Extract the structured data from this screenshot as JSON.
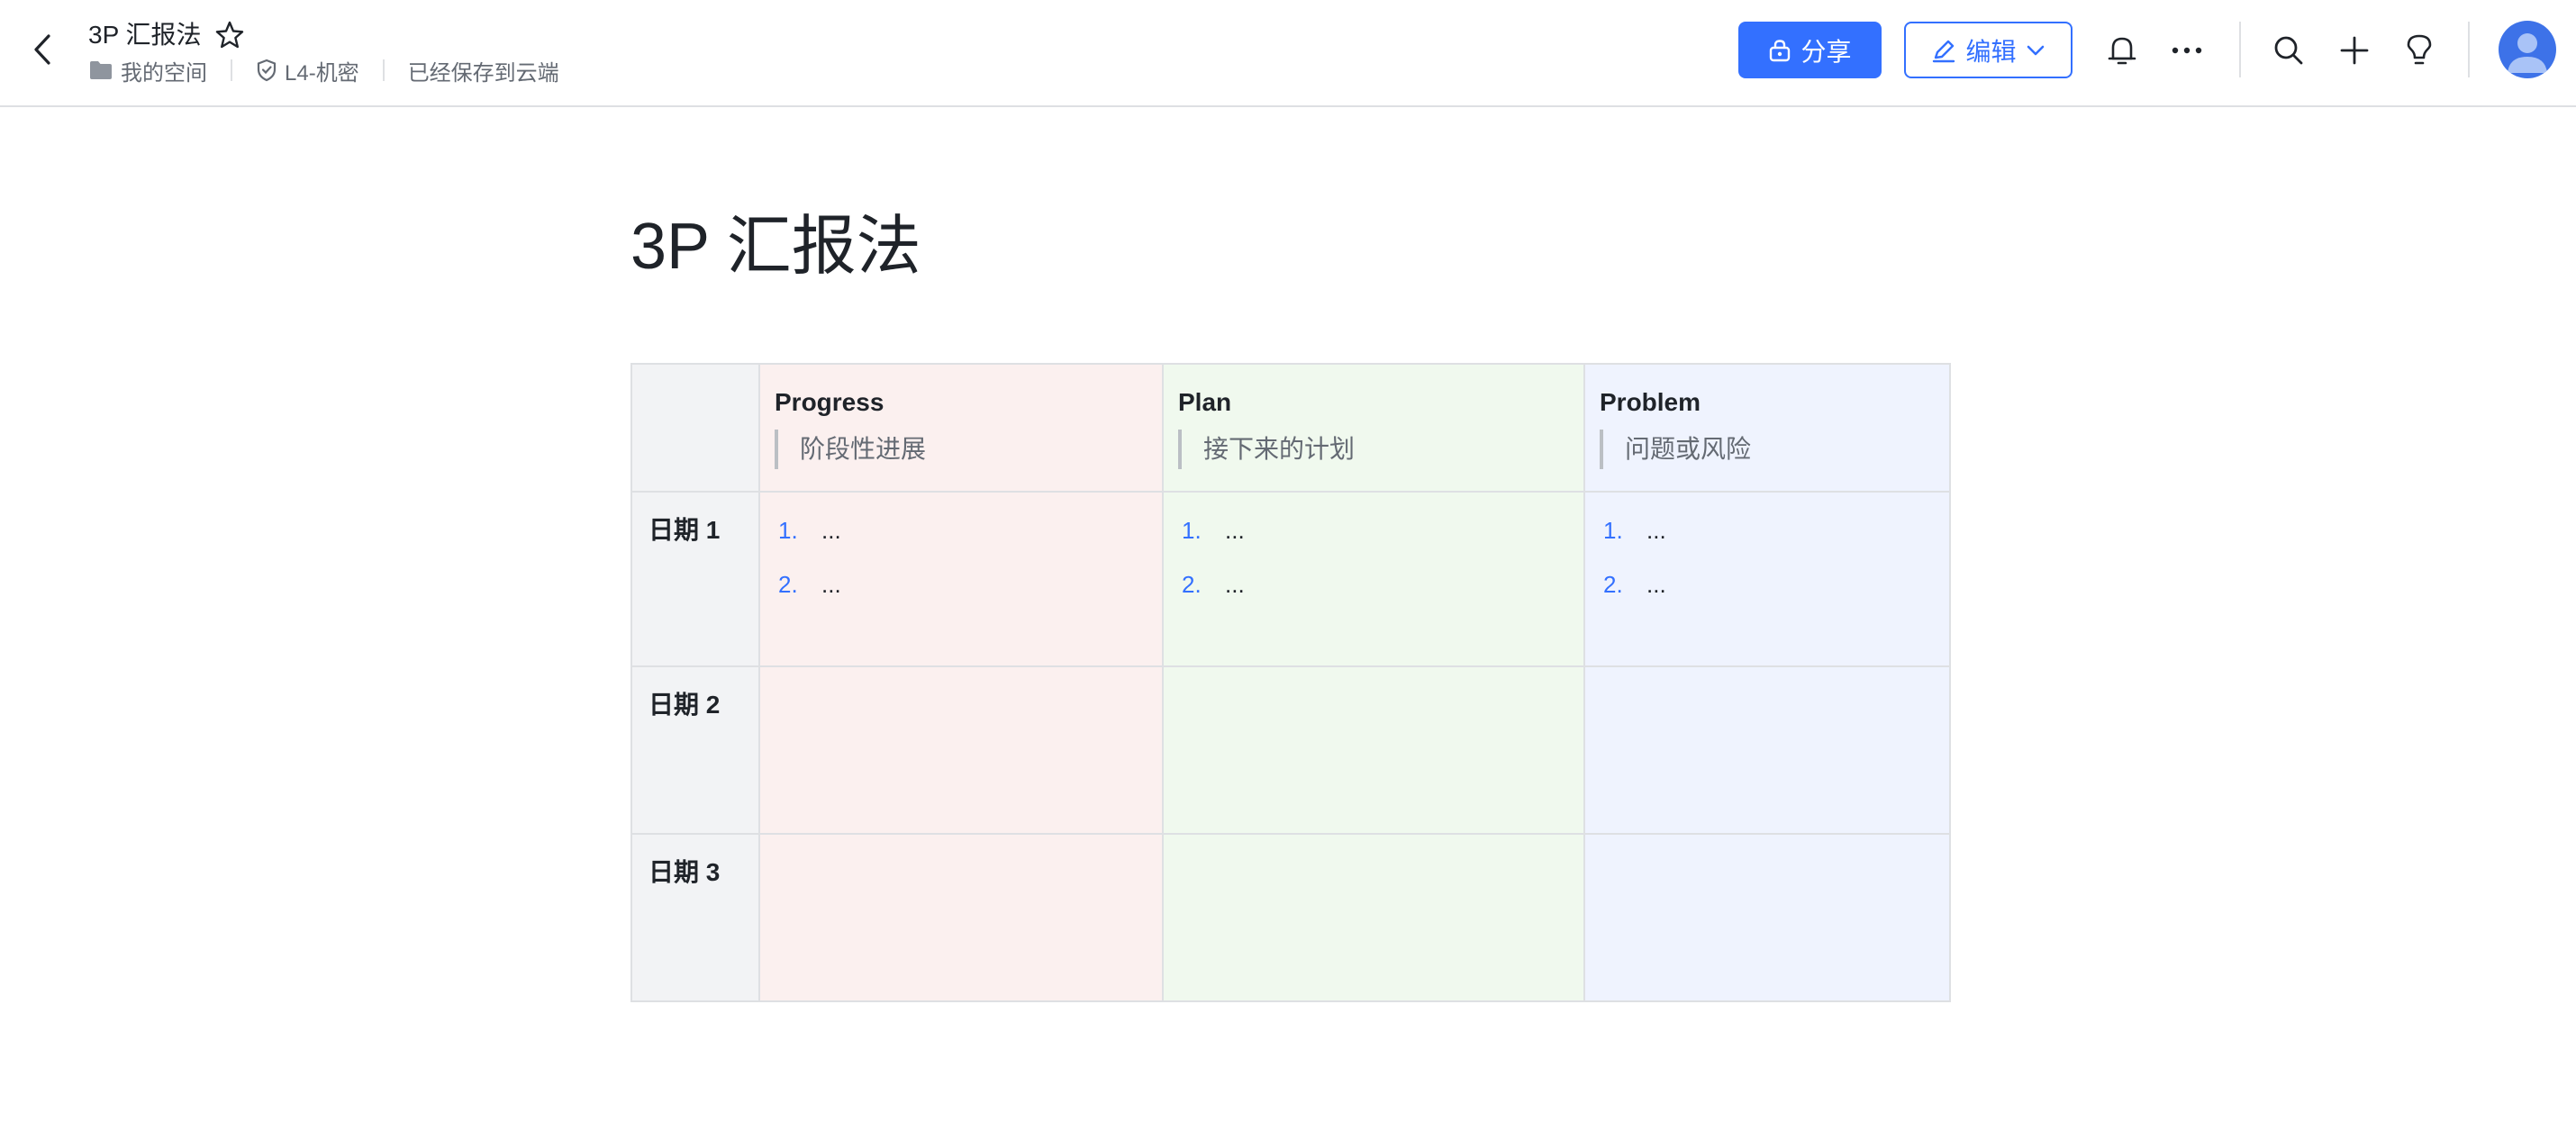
{
  "header": {
    "title": "3P 汇报法",
    "breadcrumb": {
      "space": "我的空间",
      "security_level": "L4-机密",
      "save_status": "已经保存到云端"
    },
    "share_label": "分享",
    "edit_label": "编辑",
    "icons": [
      "back-icon",
      "star-icon",
      "folder-icon",
      "shield-icon",
      "lock-icon",
      "pencil-icon",
      "chevron-down-icon",
      "bell-icon",
      "more-icon",
      "search-icon",
      "plus-icon",
      "lightbulb-icon",
      "avatar"
    ]
  },
  "document": {
    "title": "3P 汇报法",
    "table": {
      "columns": [
        {
          "title": "Progress",
          "subtitle": "阶段性进展",
          "color": "#fbf0ef"
        },
        {
          "title": "Plan",
          "subtitle": "接下来的计划",
          "color": "#f0f9ee"
        },
        {
          "title": "Problem",
          "subtitle": "问题或风险",
          "color": "#eff3fe"
        }
      ],
      "rows": [
        {
          "label": "日期 1",
          "cells": [
            [
              {
                "num": "1.",
                "text": "..."
              },
              {
                "num": "2.",
                "text": "..."
              }
            ],
            [
              {
                "num": "1.",
                "text": "..."
              },
              {
                "num": "2.",
                "text": "..."
              }
            ],
            [
              {
                "num": "1.",
                "text": "..."
              },
              {
                "num": "2.",
                "text": "..."
              }
            ]
          ]
        },
        {
          "label": "日期 2"
        },
        {
          "label": "日期 3"
        }
      ]
    }
  },
  "colors": {
    "accent": "#3370ff",
    "label_column": "#f2f3f5",
    "border": "#dee0e3"
  }
}
